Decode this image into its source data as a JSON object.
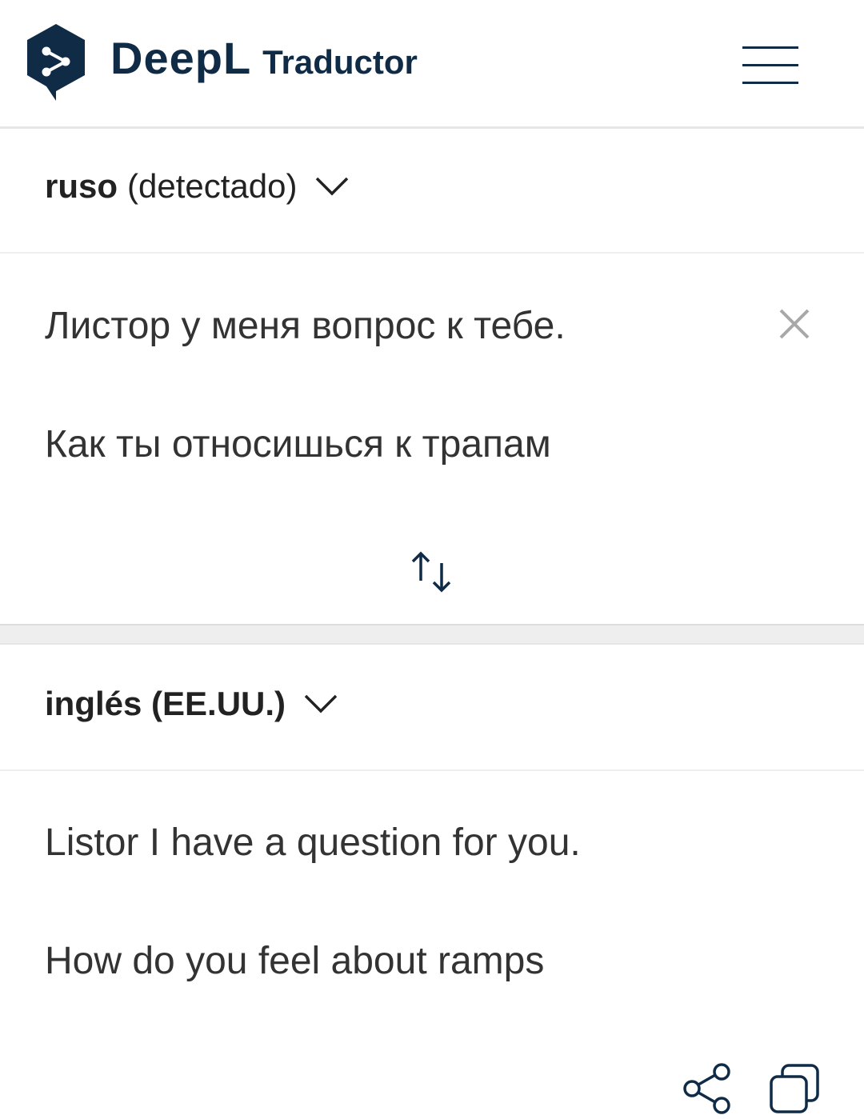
{
  "header": {
    "brand_name": "DeepL",
    "brand_sub": "Traductor",
    "logo_icon": "deepl-logo-icon",
    "menu_icon": "hamburger-menu-icon",
    "brand_color": "#0f2b46"
  },
  "source": {
    "language_bold": "ruso",
    "language_note": "(detectado)",
    "lines": [
      "Листор у меня вопрос к тебе.",
      "Как ты относишься к трапам"
    ],
    "clear_icon": "close-icon",
    "swap_icon": "swap-languages-icon"
  },
  "target": {
    "language": "inglés (EE.UU.)",
    "lines": [
      "Listor I have a question for you.",
      "How do you feel about ramps"
    ],
    "share_icon": "share-icon",
    "copy_icon": "copy-icon"
  }
}
